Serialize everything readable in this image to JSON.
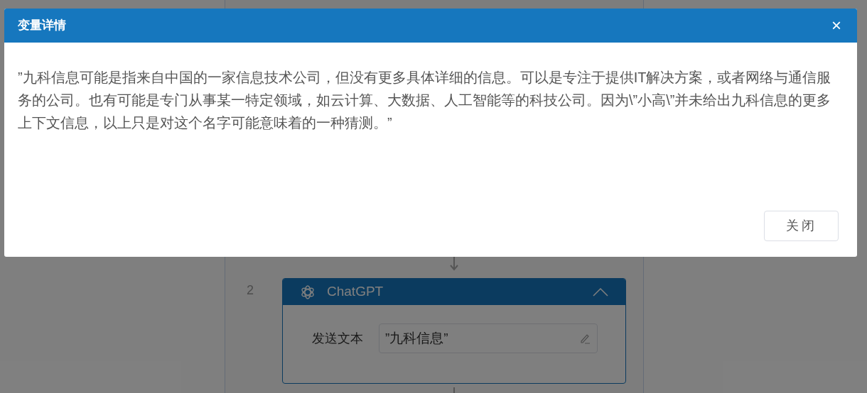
{
  "dialog": {
    "title": "变量详情",
    "close_icon": "×",
    "message": "”九科信息可能是指来自中国的一家信息技术公司，但没有更多具体详细的信息。可以是专注于提供IT解决方案，或者网络与通信服务的公司。也有可能是专门从事某一特定领域，如云计算、大数据、人工智能等的科技公司。因为\\”小高\\”并未给出九科信息的更多上下文信息，以上只是对这个名字可能意味着的一种猜测。”",
    "buttons": [
      "关闭"
    ]
  },
  "background": {
    "step": {
      "number": "2",
      "title": "ChatGPT",
      "expanded": true,
      "fields": [
        {
          "label": "发送文本",
          "value": "”九科信息”"
        }
      ]
    }
  }
}
